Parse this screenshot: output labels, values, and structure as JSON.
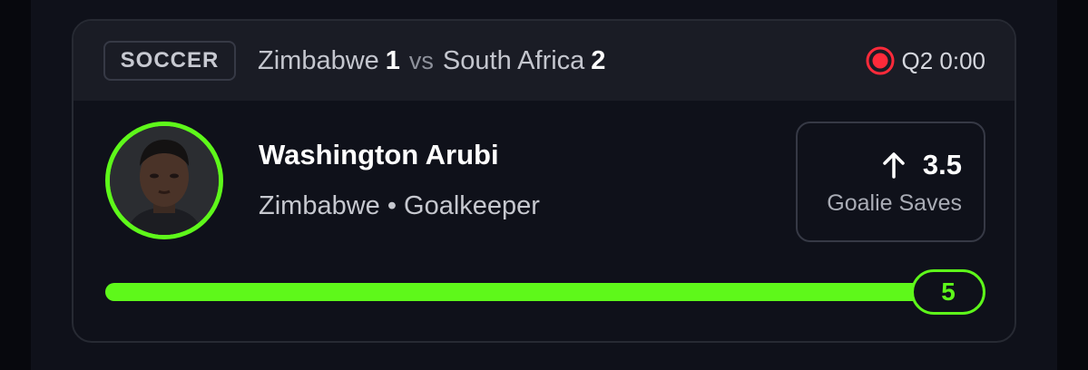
{
  "header": {
    "sport": "SOCCER",
    "home_team": "Zimbabwe",
    "home_score": "1",
    "vs": "vs",
    "away_team": "South Africa",
    "away_score": "2",
    "live_icon": "live-record-icon",
    "game_clock": "Q2 0:00"
  },
  "player": {
    "name": "Washington Arubi",
    "meta": "Zimbabwe • Goalkeeper",
    "avatar": "player-headshot"
  },
  "stat": {
    "direction_icon": "arrow-up-icon",
    "line": "3.5",
    "label": "Goalie Saves"
  },
  "progress": {
    "current": "5",
    "fill_fraction": 1.0
  },
  "colors": {
    "accent_green": "#5ef81a",
    "live_red": "#ff2a3a",
    "card_bg": "#0f111a",
    "header_bg": "#1a1c25"
  }
}
